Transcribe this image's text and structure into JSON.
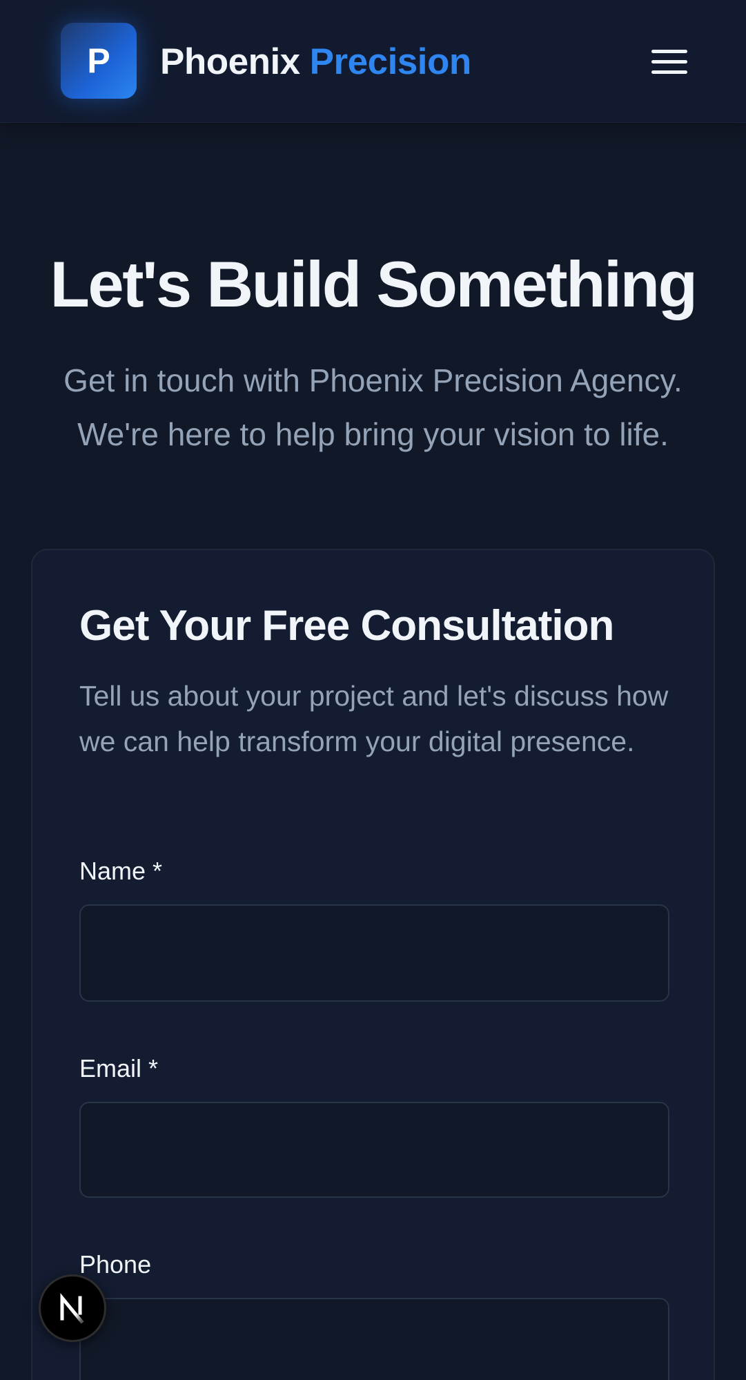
{
  "header": {
    "logo_letter": "P",
    "brand_main": "Phoenix",
    "brand_accent": "Precision",
    "menu_icon": "hamburger-menu-icon"
  },
  "hero": {
    "title": "Let's Build Something",
    "subtitle": "Get in touch with Phoenix Precision Agency. We're here to help bring your vision to life."
  },
  "form_card": {
    "title": "Get Your Free Consultation",
    "description": "Tell us about your project and let's discuss how we can help transform your digital presence.",
    "fields": [
      {
        "label": "Name *",
        "value": "",
        "placeholder": ""
      },
      {
        "label": "Email *",
        "value": "",
        "placeholder": ""
      },
      {
        "label": "Phone",
        "value": "",
        "placeholder": ""
      }
    ]
  },
  "floating_badge": {
    "icon": "nextjs-logo-icon"
  },
  "colors": {
    "background": "#111827",
    "header_background": "#111a2e",
    "card_background": "#131c30",
    "accent": "#2f86f0",
    "text_primary": "#f1f5f9",
    "text_secondary": "#94a3b8",
    "input_border": "#283447"
  }
}
